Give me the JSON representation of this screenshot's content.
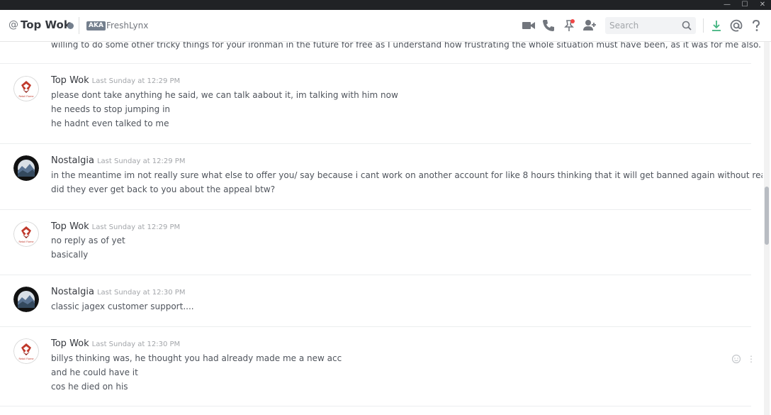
{
  "window": {
    "minimize": "—",
    "maximize": "☐",
    "close": "✕"
  },
  "header": {
    "at_symbol": "@",
    "channel_name": "Top Wok",
    "aka_badge": "AKA",
    "aka_name": "FreshLynx",
    "search_placeholder": "Search",
    "icons": [
      "video-call-icon",
      "voice-call-icon",
      "pin-icon",
      "add-friend-icon",
      "search-icon",
      "download-icon",
      "mentions-icon",
      "help-icon"
    ]
  },
  "messages": [
    {
      "continuation": "willing to do some other tricky things for your ironman in the future for free as I understand how frustrating the whole situation must have been, as it was for me also."
    },
    {
      "author": "Top Wok",
      "timestamp": "Last Sunday at 12:29 PM",
      "avatar": "retail-flame",
      "lines": [
        "please dont take anything he said, we can talk aabout it, im talking with him now",
        "he needs to stop jumping in",
        "he hadnt even talked to me"
      ]
    },
    {
      "author": "Nostalgia",
      "timestamp": "Last Sunday at 12:29 PM",
      "avatar": "mountain",
      "lines": [
        "in the meantime im not really sure what else to offer you/ say because i cant work on another account for like 8 hours thinking that it will get banned again without reason",
        "did they ever get back to you about the appeal btw?"
      ]
    },
    {
      "author": "Top Wok",
      "timestamp": "Last Sunday at 12:29 PM",
      "avatar": "retail-flame",
      "lines": [
        "no reply as of yet",
        "basically"
      ]
    },
    {
      "author": "Nostalgia",
      "timestamp": "Last Sunday at 12:30 PM",
      "avatar": "mountain",
      "lines": [
        "classic jagex customer support...."
      ]
    },
    {
      "author": "Top Wok",
      "timestamp": "Last Sunday at 12:30 PM",
      "avatar": "retail-flame",
      "lines": [
        "billys thinking was,  he thought you had already made me a new acc",
        "and he could have it",
        "cos he died on his"
      ]
    }
  ],
  "avatar_label": "Retail Flame",
  "colors": {
    "accent_red": "#c0392b",
    "status_offline": "#747f8d",
    "download_green": "#43b581"
  }
}
